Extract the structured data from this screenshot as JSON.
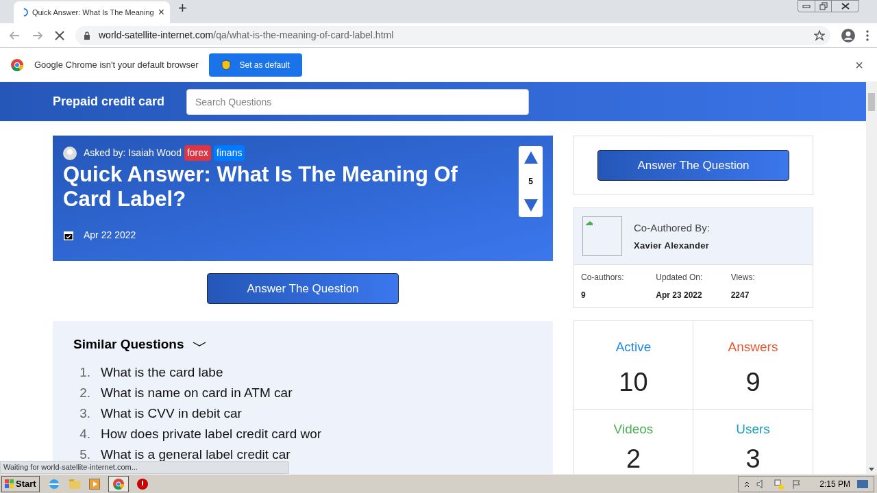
{
  "browser": {
    "tab": {
      "title": "Quick Answer: What Is The Meaning",
      "close": "×"
    },
    "new_tab": "+",
    "url": {
      "domain": "world-satellite-internet.com",
      "path": "/qa/what-is-the-meaning-of-card-label.html"
    }
  },
  "infobar": {
    "message": "Google Chrome isn't your default browser",
    "button": "Set as default",
    "close": "×"
  },
  "site_header": {
    "brand": "Prepaid credit card",
    "search": {
      "placeholder": "Search Questions"
    }
  },
  "question": {
    "asked_by": "Asked by: Isaiah Wood",
    "tags": [
      {
        "label": "forex",
        "color": "#dc3545"
      },
      {
        "label": "finans",
        "color": "#007bff"
      }
    ],
    "title": "Quick Answer: What Is The Meaning Of Card Label?",
    "date": "Apr 22 2022",
    "votes": "5"
  },
  "answer_button": "Answer The Question",
  "similar": {
    "heading": "Similar Questions",
    "items": [
      {
        "number": "1.",
        "text": "What is the card labe"
      },
      {
        "number": "2.",
        "text": "What is name on card in ATM car"
      },
      {
        "number": "3.",
        "text": "What is CVV in debit car"
      },
      {
        "number": "4.",
        "text": "How does private label credit card wor"
      },
      {
        "number": "5.",
        "text": "What is a general label credit car"
      }
    ]
  },
  "sidebar": {
    "answer_button": "Answer The Question",
    "coauthor": {
      "label": "Co-Authored By:",
      "name": "Xavier Alexander"
    },
    "meta": [
      {
        "label": "Co-authors:",
        "value": "9"
      },
      {
        "label": "Updated On:",
        "value": "Apr 23 2022"
      },
      {
        "label": "Views:",
        "value": "2247"
      }
    ],
    "stats": [
      {
        "label": "Active",
        "value": "10",
        "color": "#1e88e5"
      },
      {
        "label": "Answers",
        "value": "9",
        "color": "#e8552e"
      },
      {
        "label": "Videos",
        "value": "2",
        "color": "#4caf50"
      },
      {
        "label": "Users",
        "value": "3",
        "color": "#17a2b8"
      }
    ]
  },
  "status_bubble": "Waiting for world-satellite-internet.com...",
  "taskbar": {
    "start": "Start",
    "time": "2:15 PM"
  }
}
